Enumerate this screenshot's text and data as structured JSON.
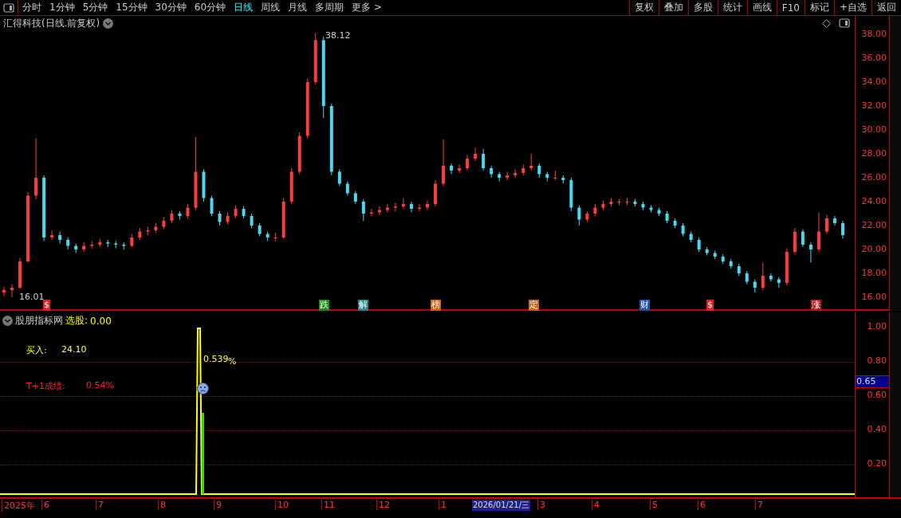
{
  "toolbar": {
    "tabs": [
      {
        "label": "分时",
        "selected": false
      },
      {
        "label": "1分钟",
        "selected": false
      },
      {
        "label": "5分钟",
        "selected": false
      },
      {
        "label": "15分钟",
        "selected": false
      },
      {
        "label": "30分钟",
        "selected": false
      },
      {
        "label": "60分钟",
        "selected": false
      },
      {
        "label": "日线",
        "selected": true
      },
      {
        "label": "周线",
        "selected": false
      },
      {
        "label": "月线",
        "selected": false
      },
      {
        "label": "多周期",
        "selected": false
      },
      {
        "label": "更多 >",
        "selected": false
      }
    ],
    "buttons": [
      "复权",
      "叠加",
      "多股",
      "统计",
      "画线",
      "F10",
      "标记",
      "+自选",
      "返回"
    ]
  },
  "price_chart": {
    "title": "汇得科技(日线.前复权)",
    "high_label": "38.12",
    "low_label": "16.01",
    "chart_data": {
      "type": "candlestick",
      "ylim": [
        14.87,
        39.53
      ],
      "yticks": [
        {
          "value": 38,
          "label": "38.00"
        },
        {
          "value": 36,
          "label": "36.00"
        },
        {
          "value": 34,
          "label": "34.00"
        },
        {
          "value": 32,
          "label": "32.00"
        },
        {
          "value": 30,
          "label": "30.00"
        },
        {
          "value": 28,
          "label": "28.00"
        },
        {
          "value": 26,
          "label": "26.00"
        },
        {
          "value": 24,
          "label": "24.00"
        },
        {
          "value": 22,
          "label": "22.00"
        },
        {
          "value": 20,
          "label": "20.00"
        },
        {
          "value": 18,
          "label": "18.00"
        },
        {
          "value": 16,
          "label": "16.00"
        }
      ],
      "categories": [
        null,
        null,
        null,
        null,
        null,
        null,
        null,
        null,
        null,
        null,
        null,
        null,
        null,
        null,
        null,
        null,
        null,
        null,
        null,
        null,
        null,
        null,
        null,
        null,
        null,
        null,
        null,
        null,
        null,
        null,
        null,
        null,
        null,
        null,
        null,
        null,
        null,
        null,
        null,
        null,
        null,
        null,
        null,
        null,
        null,
        null,
        null,
        null,
        null,
        null,
        null,
        null,
        null,
        null,
        null,
        null,
        null,
        null,
        null,
        null,
        null,
        null,
        null,
        null,
        null,
        null,
        null,
        null,
        null,
        null,
        null,
        null,
        null,
        null,
        null,
        null,
        null,
        null,
        null,
        null,
        null,
        null,
        null,
        null,
        null,
        null,
        null,
        null,
        null,
        null,
        null,
        null,
        null,
        null,
        null,
        null,
        null,
        null,
        null,
        null,
        null,
        null,
        null,
        null,
        null,
        null
      ],
      "ohlc": [
        [
          16.4,
          16.9,
          16.1,
          16.6
        ],
        [
          16.6,
          17.1,
          16.01,
          16.8
        ],
        [
          16.8,
          19.3,
          16.7,
          19.0
        ],
        [
          19.0,
          24.8,
          18.9,
          24.5
        ],
        [
          24.5,
          29.3,
          24.2,
          26.0
        ],
        [
          26.0,
          26.2,
          20.7,
          21.0
        ],
        [
          21.0,
          21.6,
          20.8,
          21.2
        ],
        [
          21.2,
          21.5,
          20.5,
          20.8
        ],
        [
          20.8,
          21.0,
          20.0,
          20.3
        ],
        [
          20.3,
          20.5,
          19.7,
          20.0
        ],
        [
          20.0,
          20.6,
          19.8,
          20.3
        ],
        [
          20.3,
          20.7,
          20.1,
          20.4
        ],
        [
          20.4,
          20.9,
          20.2,
          20.6
        ],
        [
          20.6,
          20.8,
          20.2,
          20.5
        ],
        [
          20.5,
          20.7,
          20.1,
          20.4
        ],
        [
          20.4,
          20.6,
          20.0,
          20.3
        ],
        [
          20.3,
          21.3,
          20.2,
          21.0
        ],
        [
          21.0,
          21.8,
          20.8,
          21.5
        ],
        [
          21.5,
          21.9,
          21.2,
          21.6
        ],
        [
          21.6,
          22.2,
          21.4,
          21.9
        ],
        [
          21.9,
          22.7,
          21.7,
          22.4
        ],
        [
          22.4,
          23.3,
          22.2,
          23.0
        ],
        [
          23.0,
          23.2,
          22.5,
          22.8
        ],
        [
          22.8,
          23.8,
          22.6,
          23.5
        ],
        [
          23.5,
          29.4,
          23.3,
          26.5
        ],
        [
          26.5,
          26.7,
          24.0,
          24.3
        ],
        [
          24.3,
          24.5,
          22.8,
          23.0
        ],
        [
          23.0,
          23.2,
          22.0,
          22.3
        ],
        [
          22.3,
          23.1,
          22.1,
          22.8
        ],
        [
          22.8,
          23.7,
          22.6,
          23.4
        ],
        [
          23.4,
          23.6,
          22.6,
          22.8
        ],
        [
          22.8,
          23.0,
          21.8,
          22.0
        ],
        [
          22.0,
          22.2,
          21.1,
          21.3
        ],
        [
          21.3,
          21.5,
          20.7,
          21.0
        ],
        [
          21.0,
          21.4,
          20.7,
          21.0
        ],
        [
          21.0,
          24.3,
          20.9,
          24.0
        ],
        [
          24.0,
          26.8,
          23.8,
          26.5
        ],
        [
          26.5,
          29.8,
          26.3,
          29.5
        ],
        [
          29.5,
          34.3,
          29.3,
          34.0
        ],
        [
          34.0,
          38.12,
          33.8,
          37.5
        ],
        [
          37.5,
          37.8,
          31.0,
          32.0
        ],
        [
          32.0,
          32.2,
          26.2,
          26.5
        ],
        [
          26.5,
          26.7,
          25.3,
          25.5
        ],
        [
          25.5,
          25.7,
          24.5,
          24.7
        ],
        [
          24.7,
          24.9,
          23.8,
          24.0
        ],
        [
          24.0,
          24.2,
          22.4,
          23.0
        ],
        [
          23.0,
          23.4,
          22.8,
          23.1
        ],
        [
          23.1,
          23.6,
          22.9,
          23.3
        ],
        [
          23.3,
          23.8,
          23.1,
          23.5
        ],
        [
          23.5,
          23.9,
          23.2,
          23.6
        ],
        [
          23.6,
          24.3,
          23.4,
          23.8
        ],
        [
          23.8,
          24.0,
          23.1,
          23.4
        ],
        [
          23.4,
          23.8,
          23.2,
          23.5
        ],
        [
          23.5,
          24.1,
          23.3,
          23.8
        ],
        [
          23.8,
          25.8,
          23.6,
          25.5
        ],
        [
          25.5,
          29.2,
          25.3,
          27.0
        ],
        [
          27.0,
          27.2,
          26.3,
          26.6
        ],
        [
          26.6,
          27.1,
          26.4,
          26.8
        ],
        [
          26.8,
          27.9,
          26.6,
          27.6
        ],
        [
          27.6,
          28.5,
          27.4,
          28.0
        ],
        [
          28.0,
          28.4,
          26.6,
          26.8
        ],
        [
          26.8,
          27.0,
          26.0,
          26.3
        ],
        [
          26.3,
          26.5,
          25.7,
          26.0
        ],
        [
          26.0,
          26.5,
          25.8,
          26.2
        ],
        [
          26.2,
          26.7,
          26.0,
          26.4
        ],
        [
          26.4,
          27.1,
          26.2,
          26.8
        ],
        [
          26.8,
          28.0,
          26.6,
          27.0
        ],
        [
          27.0,
          27.2,
          26.0,
          26.3
        ],
        [
          26.3,
          26.5,
          25.7,
          26.0
        ],
        [
          26.0,
          26.6,
          25.8,
          26.0
        ],
        [
          26.0,
          26.2,
          25.5,
          25.8
        ],
        [
          25.8,
          26.0,
          23.2,
          23.5
        ],
        [
          23.5,
          23.7,
          22.0,
          22.5
        ],
        [
          22.5,
          23.2,
          22.3,
          23.0
        ],
        [
          23.0,
          23.8,
          22.8,
          23.5
        ],
        [
          23.5,
          24.1,
          23.3,
          23.8
        ],
        [
          23.8,
          24.3,
          23.6,
          24.0
        ],
        [
          24.0,
          24.2,
          23.7,
          24.0
        ],
        [
          24.0,
          24.3,
          23.7,
          24.0
        ],
        [
          24.0,
          24.2,
          23.6,
          23.8
        ],
        [
          23.8,
          24.0,
          23.3,
          23.5
        ],
        [
          23.5,
          23.7,
          23.1,
          23.3
        ],
        [
          23.3,
          23.5,
          22.8,
          23.0
        ],
        [
          23.0,
          23.2,
          22.2,
          22.4
        ],
        [
          22.4,
          22.6,
          21.8,
          22.0
        ],
        [
          22.0,
          22.2,
          21.1,
          21.3
        ],
        [
          21.3,
          21.5,
          20.6,
          20.8
        ],
        [
          20.8,
          21.0,
          19.8,
          20.0
        ],
        [
          20.0,
          20.2,
          19.5,
          19.7
        ],
        [
          19.7,
          19.9,
          19.2,
          19.4
        ],
        [
          19.4,
          19.6,
          18.8,
          19.0
        ],
        [
          19.0,
          19.2,
          18.4,
          18.6
        ],
        [
          18.6,
          18.8,
          17.8,
          18.0
        ],
        [
          18.0,
          18.2,
          17.1,
          17.3
        ],
        [
          17.3,
          17.5,
          16.4,
          16.8
        ],
        [
          16.8,
          18.9,
          16.6,
          17.8
        ],
        [
          17.8,
          18.0,
          17.3,
          17.5
        ],
        [
          17.5,
          17.7,
          16.8,
          17.2
        ],
        [
          17.2,
          20.1,
          17.0,
          19.8
        ],
        [
          19.8,
          21.8,
          19.6,
          21.5
        ],
        [
          21.5,
          21.7,
          20.2,
          20.4
        ],
        [
          20.4,
          20.6,
          18.9,
          20.0
        ],
        [
          20.0,
          23.1,
          19.8,
          21.5
        ],
        [
          21.5,
          22.9,
          21.3,
          22.6
        ],
        [
          22.6,
          22.8,
          22.0,
          22.2
        ],
        [
          22.2,
          22.4,
          20.9,
          21.2
        ]
      ]
    },
    "event_markers": [
      {
        "text": "$",
        "color": "#e02020"
      },
      {
        "text": "跌",
        "color": "#1a8a1a"
      },
      {
        "text": "解",
        "color": "#1a8a8a"
      },
      {
        "text": "榜",
        "color": "#c86414"
      },
      {
        "text": "定",
        "color": "#c86414"
      },
      {
        "text": "财",
        "color": "#2050b0"
      },
      {
        "text": "$",
        "color": "#e02020"
      },
      {
        "text": "涨",
        "color": "#b01818"
      }
    ]
  },
  "indicator": {
    "name": "股朋指标网",
    "select_label": "选股:",
    "select_value": "0.00",
    "buy_label": "买入:",
    "buy_value": "24.10",
    "result_label": "T+1成绩:",
    "result_value": "0.54%",
    "spike_value": "0.539",
    "spike_unit": "%",
    "axis_labels": [
      "1.00",
      "0.80",
      "0.60",
      "0.40",
      "0.20"
    ],
    "current_value": "0.65"
  },
  "date_axis": {
    "labels": [
      "2025年",
      "6",
      "7",
      "8",
      "9",
      "10",
      "11",
      "12",
      "1"
    ],
    "cursor_label": "2026/01/21/三",
    "labels_after": [
      "3",
      "4",
      "5",
      "6",
      "7"
    ]
  }
}
